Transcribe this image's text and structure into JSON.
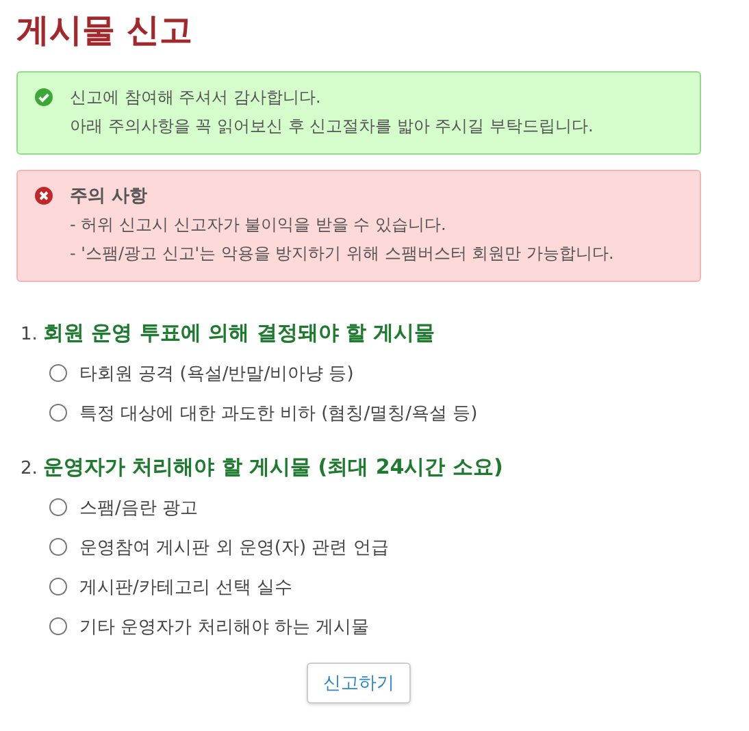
{
  "title": "게시물 신고",
  "alerts": [
    {
      "kind": "success",
      "lines": [
        "신고에 참여해 주셔서 감사합니다.",
        "아래 주의사항을 꼭 읽어보신 후 신고절차를 밟아 주시길 부탁드립니다."
      ]
    },
    {
      "kind": "danger",
      "heading": "주의 사항",
      "lines": [
        "- 허위 신고시 신고자가 불이익을 받을 수 있습니다.",
        "- '스팸/광고 신고'는 악용을 방지하기 위해 스팸버스터 회원만 가능합니다."
      ]
    }
  ],
  "sections": [
    {
      "number": "1.",
      "title": "회원 운영 투표에 의해 결정돼야 할 게시물",
      "options": [
        {
          "label": "타회원 공격 (욕설/반말/비아냥 등)",
          "selected": false
        },
        {
          "label": "특정 대상에 대한 과도한 비하 (혐칭/멸칭/욕설 등)",
          "selected": false
        }
      ]
    },
    {
      "number": "2.",
      "title": "운영자가 처리해야 할 게시물 (최대 24시간 소요)",
      "options": [
        {
          "label": "스팸/음란 광고",
          "selected": false
        },
        {
          "label": "운영참여 게시판 외 운영(자) 관련 언급",
          "selected": false
        },
        {
          "label": "게시판/카테고리 선택 실수",
          "selected": false
        },
        {
          "label": "기타 운영자가 처리해야 하는 게시물",
          "selected": false
        }
      ]
    }
  ],
  "submit_button": "신고하기"
}
